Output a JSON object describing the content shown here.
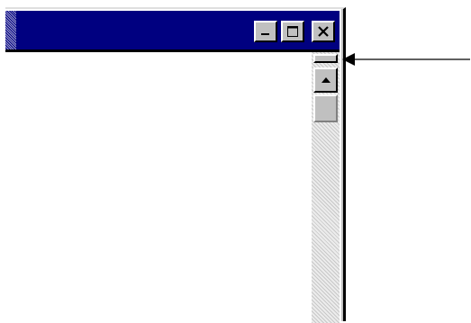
{
  "window": {
    "title": "",
    "controls": {
      "minimize": "minimize-icon",
      "maximize": "maximize-icon",
      "close": "close-icon"
    }
  },
  "scrollbar": {
    "up_arrow": "up-arrow-icon"
  },
  "colors": {
    "title_bar": "#000080",
    "face": "#c0c0c0",
    "track": "#e4e4e4"
  }
}
